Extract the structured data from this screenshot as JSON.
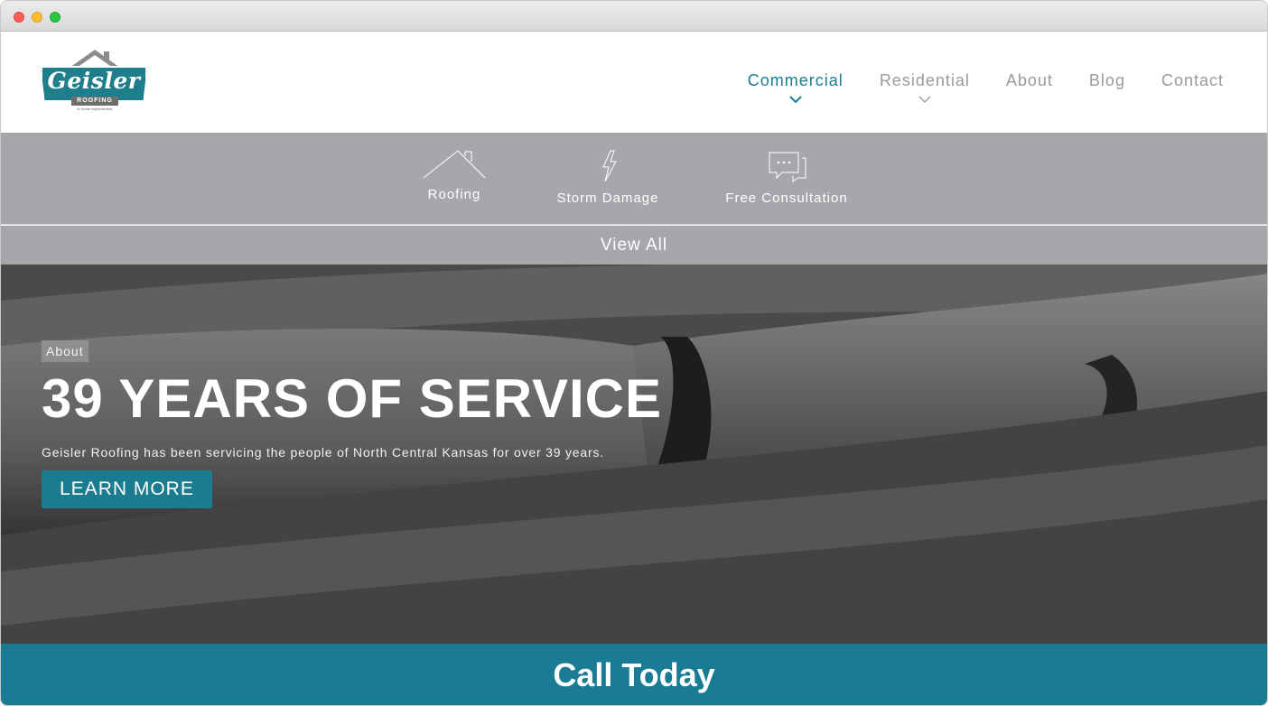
{
  "logo": {
    "brand": "Geisler",
    "sub": "ROOFING",
    "tag": "& Home Improvement"
  },
  "nav": {
    "items": [
      {
        "label": "Commercial",
        "dropdown": true,
        "active": true
      },
      {
        "label": "Residential",
        "dropdown": true,
        "active": false
      },
      {
        "label": "About",
        "dropdown": false,
        "active": false
      },
      {
        "label": "Blog",
        "dropdown": false,
        "active": false
      },
      {
        "label": "Contact",
        "dropdown": false,
        "active": false
      }
    ]
  },
  "services": [
    {
      "label": "Roofing",
      "icon": "house-roof-icon"
    },
    {
      "label": "Storm Damage",
      "icon": "lightning-icon"
    },
    {
      "label": "Free Consultation",
      "icon": "chat-bubbles-icon"
    }
  ],
  "view_all": "View All",
  "hero": {
    "tag": "About",
    "title": "39 YEARS OF SERVICE",
    "text": "Geisler Roofing has been servicing the people of North Central Kansas for over 39 years.",
    "button": "LEARN MORE"
  },
  "cta": "Call Today",
  "colors": {
    "accent": "#1a7c8e",
    "subnav": "#a6a7ab",
    "cta": "#1a7c94"
  }
}
